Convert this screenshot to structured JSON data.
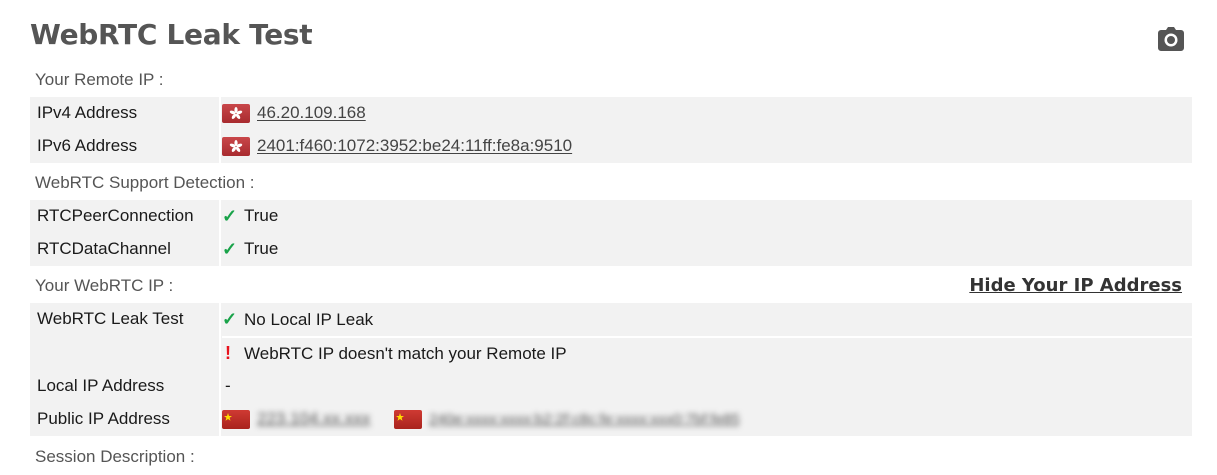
{
  "title": "WebRTC Leak Test",
  "sections": {
    "remote_ip": "Your Remote IP :",
    "support": "WebRTC Support Detection :",
    "webrtc_ip": "Your WebRTC IP :",
    "session": "Session Description :"
  },
  "remote": {
    "ipv4_label": "IPv4 Address",
    "ipv4_value": "46.20.109.168",
    "ipv6_label": "IPv6 Address",
    "ipv6_value": "2401:f460:1072:3952:be24:11ff:fe8a:9510"
  },
  "support": {
    "peer_label": "RTCPeerConnection",
    "peer_value": "True",
    "data_label": "RTCDataChannel",
    "data_value": "True"
  },
  "webrtc": {
    "hide_link": "Hide Your IP Address",
    "leak_label": "WebRTC Leak Test",
    "leak_result_1": "No Local IP Leak",
    "leak_result_2": "WebRTC IP doesn't match your Remote IP",
    "local_label": "Local IP Address",
    "local_value": "-",
    "public_label": "Public IP Address",
    "public_ipv4_blurred": "223.104.xx.xxx",
    "public_ipv6_blurred": "240e:xxxx:xxxx:b2:2f:c8c:fe:xxxx:xxx0:7bf:fe85"
  },
  "colors": {
    "check": "#1aa34a",
    "warning": "#e8121d",
    "row_bg": "#f2f2f2",
    "title": "#555555"
  },
  "icons": {
    "camera": "camera-icon",
    "hk_flag": "hong-kong-flag-icon",
    "cn_flag": "china-flag-icon"
  }
}
